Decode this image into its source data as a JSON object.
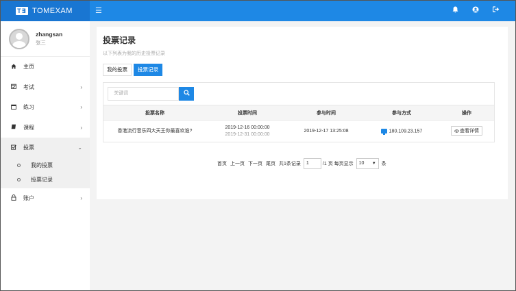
{
  "app": {
    "logo_text": "T∃",
    "brand_name": "TOMEXAM",
    "colors": {
      "primary": "#1e88e5",
      "brand_bg": "#1976d2",
      "sidebar_bg": "#ffffff",
      "page_bg": "#f3f3f3"
    }
  },
  "topbar": {
    "menu_icon": "☰",
    "icons": {
      "bell": "🔔",
      "user": "●",
      "logout": "⇥"
    }
  },
  "user": {
    "username": "zhangsan",
    "real_name": "张三"
  },
  "sidebar": {
    "items": [
      {
        "icon": "⌂",
        "label": "主页",
        "chevron": ""
      },
      {
        "icon": "☑",
        "label": "考试",
        "chevron": "›"
      },
      {
        "icon": "▦",
        "label": "练习",
        "chevron": "›"
      },
      {
        "icon": "■",
        "label": "课程",
        "chevron": "›"
      },
      {
        "icon": "☑",
        "label": "投票",
        "chevron": "⌄"
      },
      {
        "icon": "⌂",
        "label": "账户",
        "chevron": "›"
      }
    ],
    "vote_submenu": [
      {
        "label": "我的投票"
      },
      {
        "label": "投票记录"
      }
    ]
  },
  "main": {
    "title": "投票记录",
    "subtitle": "以下列表为我的历史投票记录",
    "tabs": [
      {
        "label": "我的投票"
      },
      {
        "label": "投票记录"
      }
    ],
    "search": {
      "placeholder": "关键词",
      "button_icon": "🔍"
    },
    "table": {
      "headers": [
        "投票名称",
        "投票时间",
        "参与时间",
        "参与方式",
        "操作"
      ],
      "rows": [
        {
          "name": "香港流行音乐四大天王你最喜欢谁?",
          "vote_start": "2019-12-16 00:00:00",
          "vote_end": "2019-12-31 00:00:00",
          "join_time": "2019-12-17 13:25:08",
          "join_method": "180.109.23.157",
          "action": "查看详情"
        }
      ]
    },
    "pagination": {
      "first": "首页",
      "prev": "上一页",
      "next": "下一页",
      "last": "尾页",
      "total": "共1条记录",
      "page_value": "1",
      "page_suffix": "/1 页 每页显示",
      "page_size": "10",
      "size_suffix": "条"
    }
  }
}
